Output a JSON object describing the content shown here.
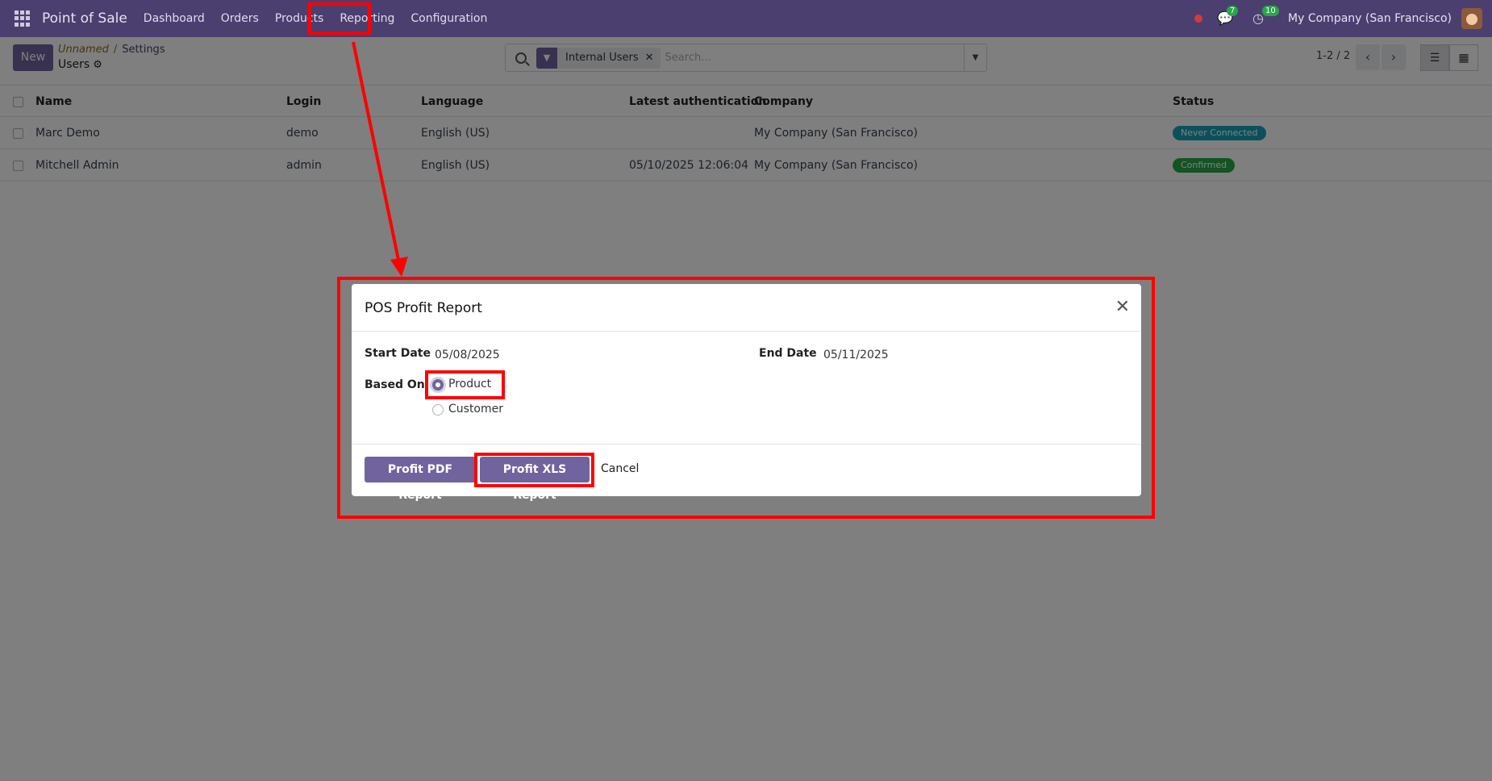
{
  "navbar": {
    "brand": "Point of Sale",
    "menu": [
      "Dashboard",
      "Orders",
      "Products",
      "Reporting",
      "Configuration"
    ],
    "messages_count": "7",
    "activities_count": "10",
    "company": "My Company (San Francisco)"
  },
  "control_panel": {
    "new_label": "New",
    "breadcrumb_unnamed": "Unnamed",
    "breadcrumb_separator": "/",
    "breadcrumb_settings": "Settings",
    "title": "Users",
    "facet_label": "Internal Users",
    "search_placeholder": "Search...",
    "pager": "1-2 / 2"
  },
  "table": {
    "headers": [
      "Name",
      "Login",
      "Language",
      "Latest authentication",
      "Company",
      "Status"
    ],
    "rows": [
      {
        "name": "Marc Demo",
        "login": "demo",
        "language": "English (US)",
        "latest_auth": "",
        "company": "My Company (San Francisco)",
        "status": "Never Connected",
        "status_color": "#17a2b8"
      },
      {
        "name": "Mitchell Admin",
        "login": "admin",
        "language": "English (US)",
        "latest_auth": "05/10/2025 12:06:04",
        "company": "My Company (San Francisco)",
        "status": "Confirmed",
        "status_color": "#28a745"
      }
    ]
  },
  "dialog": {
    "title": "POS Profit Report",
    "start_date_label": "Start Date",
    "start_date": "05/08/2025",
    "end_date_label": "End Date",
    "end_date": "05/11/2025",
    "based_on_label": "Based On",
    "options": [
      "Product",
      "Customer"
    ],
    "selected_option": "Product",
    "pdf_button": "Profit PDF Report",
    "xls_button": "Profit XLS Report",
    "cancel_button": "Cancel"
  },
  "colors": {
    "navbar": "#4b3f6f",
    "primary": "#71639e",
    "annotation": "#ff0000"
  }
}
